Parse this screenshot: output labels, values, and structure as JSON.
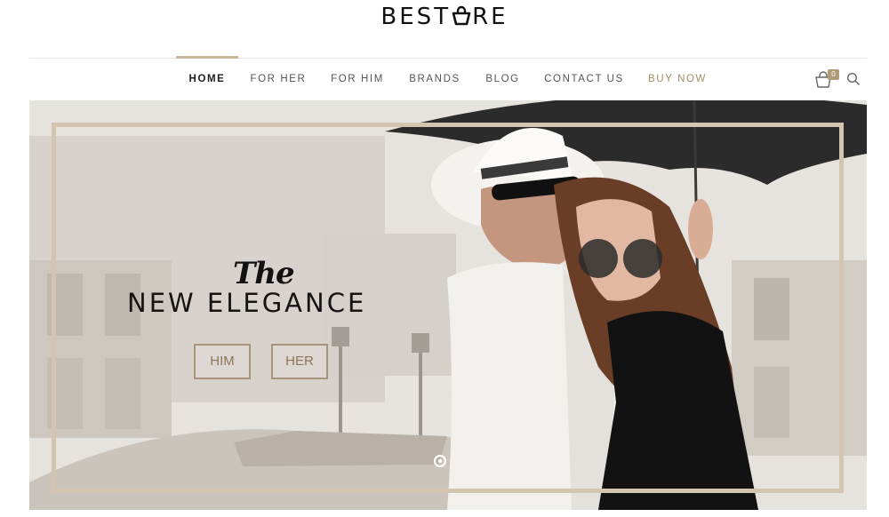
{
  "brand": {
    "name_prefix": "BEST",
    "name_suffix": "RE"
  },
  "nav": {
    "items": [
      "HOME",
      "FOR HER",
      "FOR HIM",
      "BRANDS",
      "BLOG",
      "CONTACT US",
      "BUY NOW"
    ],
    "active": "HOME"
  },
  "cart": {
    "count": "0",
    "icon": "shopping-bag-icon"
  },
  "search": {
    "icon": "search-icon"
  },
  "hero": {
    "script_text": "The",
    "headline": "NEW ELEGANCE",
    "buttons": {
      "him": "HIM",
      "her": "HER"
    },
    "slide_indicator": "slide-dot"
  },
  "colors": {
    "accent": "#c9b79c",
    "buy_now": "#a48c64",
    "button_border": "#a89477",
    "frame": "#d3c5ae"
  }
}
